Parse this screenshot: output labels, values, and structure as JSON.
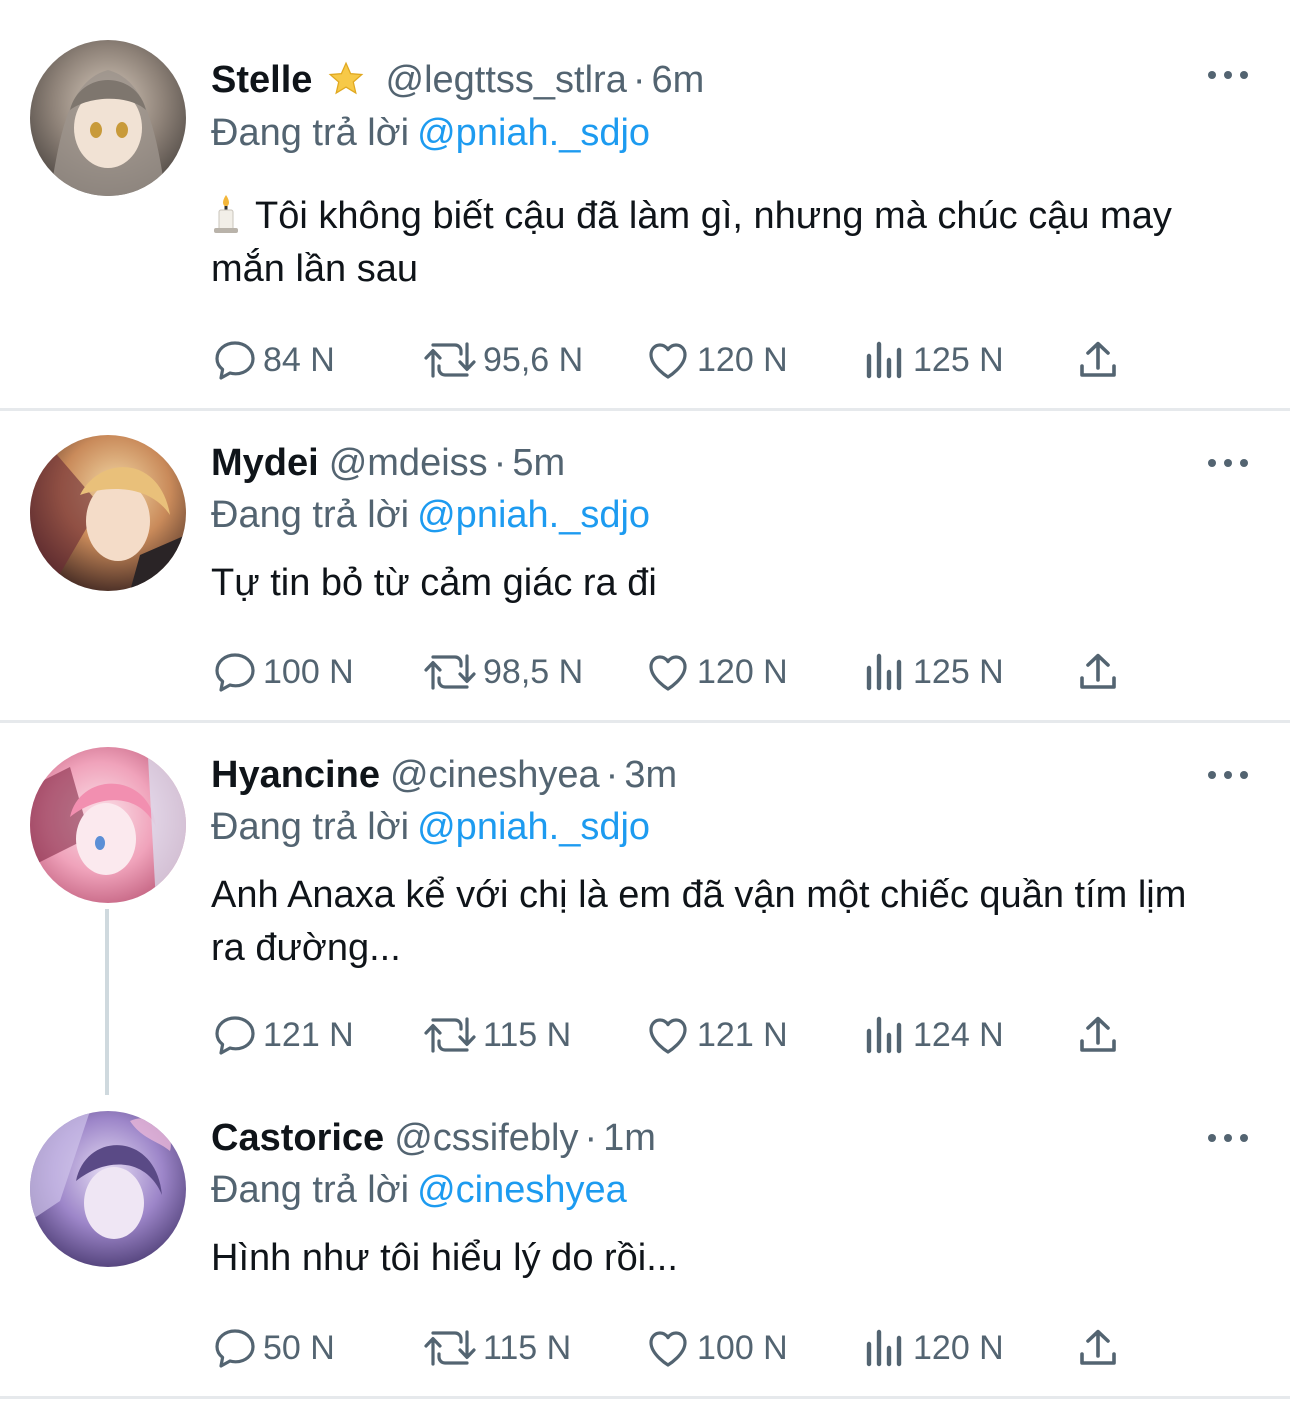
{
  "reply_prefix": "Đang trả lời",
  "tweets": [
    {
      "name": "Stelle",
      "verified_icon": "star-icon",
      "handle": "@legttss_stlra",
      "time": "6m",
      "reply_to": "@pniah._sdjo",
      "text_emoji": "candle-emoji",
      "text": "Tôi không biết cậu đã làm gì, nhưng mà chúc cậu may mắn lần sau",
      "stats": {
        "replies": "84 N",
        "retweets": "95,6 N",
        "likes": "120 N",
        "views": "125 N"
      }
    },
    {
      "name": "Mydei",
      "handle": "@mdeiss",
      "time": "5m",
      "reply_to": "@pniah._sdjo",
      "text": "Tự tin bỏ từ cảm giác ra đi",
      "stats": {
        "replies": "100 N",
        "retweets": "98,5 N",
        "likes": "120 N",
        "views": "125 N"
      }
    },
    {
      "name": "Hyancine",
      "handle": "@cineshyea",
      "time": "3m",
      "reply_to": "@pniah._sdjo",
      "text": "Anh Anaxa kể với chị là em đã vận một chiếc quần tím lịm ra đường...",
      "stats": {
        "replies": "121 N",
        "retweets": "115 N",
        "likes": "121 N",
        "views": "124 N"
      }
    },
    {
      "name": "Castorice",
      "handle": "@cssifebly",
      "time": "1m",
      "reply_to": "@cineshyea",
      "text": "Hình như tôi hiểu lý do rồi...",
      "stats": {
        "replies": "50 N",
        "retweets": "115 N",
        "likes": "100 N",
        "views": "120 N"
      }
    }
  ],
  "colors": {
    "text": "#0f1419",
    "muted": "#536471",
    "link": "#1d9bf0",
    "divider": "#e6e9ec"
  }
}
